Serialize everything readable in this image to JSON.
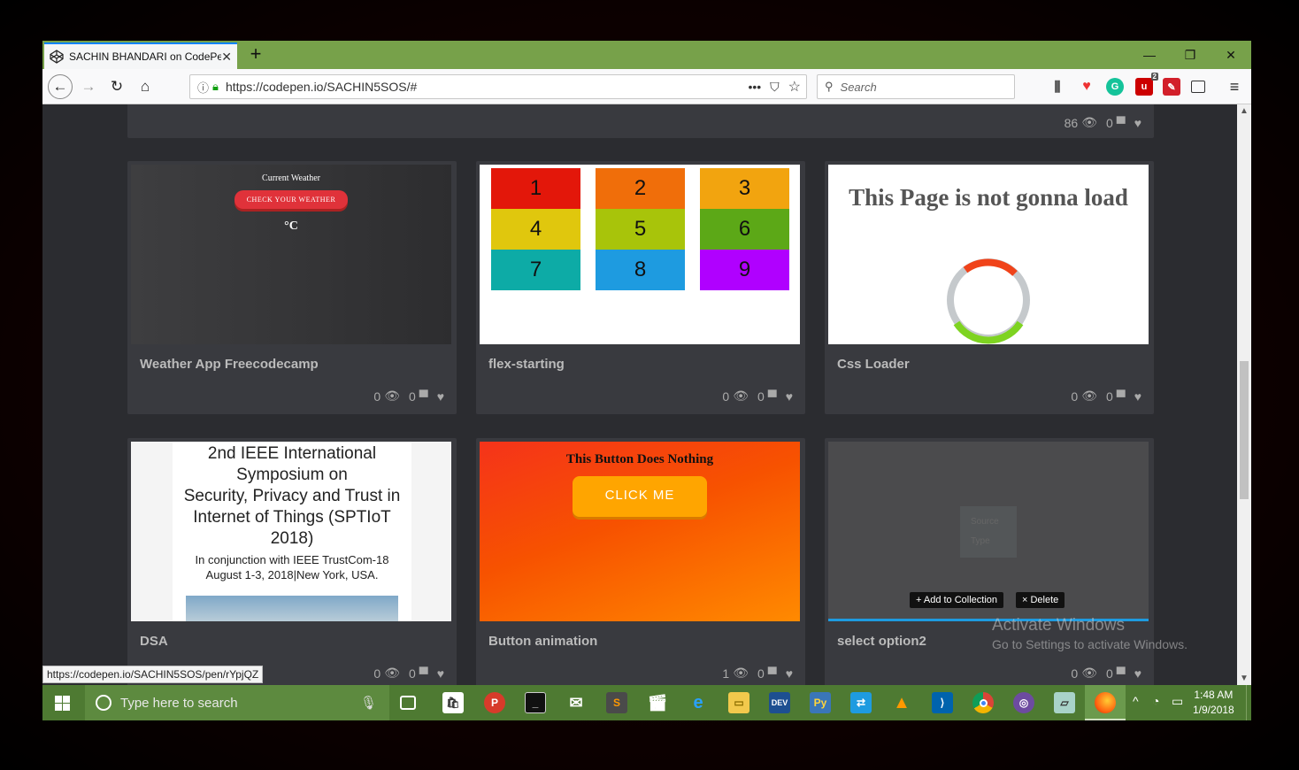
{
  "browser": {
    "tab_title": "SACHIN BHANDARI on CodePen",
    "new_tab": "+",
    "url": "https://codepen.io/SACHIN5SOS/#",
    "url_actions": "•••",
    "search_placeholder": "Search",
    "badge_count": "2"
  },
  "top_card": {
    "views": "86",
    "comments": "0"
  },
  "cards": [
    {
      "title": "Weather App Freecodecamp",
      "views": "0",
      "comments": "0",
      "preview": {
        "heading": "Current Weather",
        "button": "CHECK YOUR WEATHER",
        "unit": "°C"
      }
    },
    {
      "title": "flex-starting",
      "views": "0",
      "comments": "0",
      "preview": {
        "cells": [
          "1",
          "2",
          "3",
          "4",
          "5",
          "6",
          "7",
          "8",
          "9"
        ],
        "colors": [
          "#e3170a",
          "#f06e0a",
          "#f2a40f",
          "#e0c70d",
          "#a8c40a",
          "#5ca817",
          "#0daba6",
          "#1e9be0",
          "#b000ff"
        ]
      }
    },
    {
      "title": "Css Loader",
      "views": "0",
      "comments": "0",
      "preview": {
        "heading": "This Page is not gonna load"
      }
    },
    {
      "title": "DSA",
      "views": "0",
      "comments": "0",
      "preview": {
        "line1": "2nd IEEE International",
        "line2": "Symposium on",
        "line3": "Security, Privacy and Trust in",
        "line4": "Internet of Things (SPTIoT",
        "line5": "2018)",
        "sub1": "In conjunction with IEEE TrustCom-18",
        "sub2": "August 1-3, 2018|New York, USA."
      }
    },
    {
      "title": "Button animation",
      "views": "1",
      "comments": "0",
      "preview": {
        "heading": "This Button Does Nothing",
        "button": "CLICK ME"
      }
    },
    {
      "title": "select option2",
      "views": "0",
      "comments": "0",
      "preview": {
        "opt1": "Source",
        "opt2": "Type",
        "add": "+ Add to Collection",
        "del": "× Delete"
      }
    }
  ],
  "status_url": "https://codepen.io/SACHIN5SOS/pen/rYpjQZ",
  "watermark": {
    "title": "Activate Windows",
    "sub": "Go to Settings to activate Windows."
  },
  "taskbar": {
    "search_placeholder": "Type here to search",
    "time": "1:48 AM",
    "date": "1/9/2018"
  }
}
